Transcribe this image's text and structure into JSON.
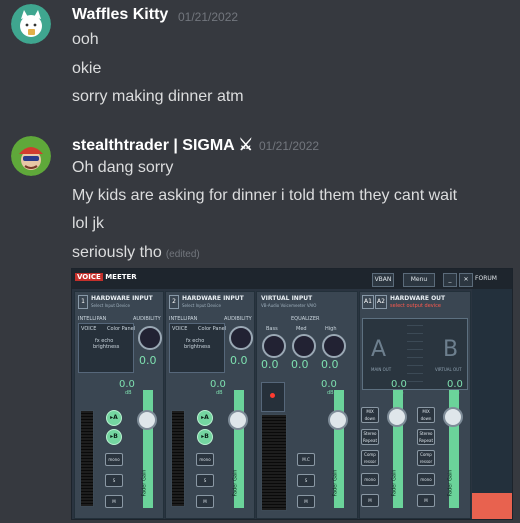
{
  "messages": [
    {
      "username": "Waffles Kitty",
      "timestamp": "01/21/2022",
      "avatar_colors": {
        "bg": "#3fa68f",
        "fg": "#ffffff"
      },
      "lines": [
        "ooh",
        "okie",
        "sorry making dinner atm"
      ]
    },
    {
      "username": "stealthtrader | SIGMA ⚔",
      "timestamp": "01/21/2022",
      "avatar_colors": {
        "bg": "#5fa83a",
        "fg": "#d13b2e"
      },
      "lines": [
        "Oh dang sorry",
        "My kids are asking for dinner i told them they cant wait",
        "lol jk",
        "seriously tho"
      ],
      "edited_label": "(edited)"
    }
  ],
  "attachment": {
    "title_voice": "VOICE",
    "title_meeter": "MEETER",
    "vban_label": "VBAN",
    "menu_label": "Menu",
    "min_label": "_",
    "close_label": "✕",
    "forum_label": "FORUM",
    "strips": [
      {
        "number": "1",
        "header": "HARDWARE INPUT",
        "sub": "Select Input Device",
        "intelli_label": "INTELLIPAN",
        "audibility_label": "AUDIBILITY",
        "voice_label": "VOICE",
        "color_panel_label": "Color Panel",
        "fx_label": "fx echo",
        "brightness_label": "brightness",
        "value": "0.0",
        "db": "0.0",
        "db_unit": "dB",
        "a_label": "▸A",
        "b_label": "▸B",
        "mono_label": "mono",
        "solo_label": "S",
        "mute_label": "M",
        "fader_label": "Fader Gain"
      },
      {
        "number": "2",
        "header": "HARDWARE INPUT",
        "sub": "Select Input Device",
        "intelli_label": "INTELLIPAN",
        "audibility_label": "AUDIBILITY",
        "voice_label": "VOICE",
        "color_panel_label": "Color Panel",
        "fx_label": "fx echo",
        "brightness_label": "brightness",
        "value": "0.0",
        "db": "0.0",
        "db_unit": "dB",
        "a_label": "▸A",
        "b_label": "▸B",
        "mono_label": "mono",
        "solo_label": "S",
        "mute_label": "M",
        "fader_label": "Fader Gain"
      }
    ],
    "virtual": {
      "header": "VIRTUAL INPUT",
      "sub": "VB-Audio Voicemeeter VAIO",
      "eq_label": "EQUALIZER",
      "bass": "Bass",
      "med": "Med",
      "high": "High",
      "eq_values": [
        "0.0",
        "0.0",
        "0.0"
      ],
      "db": "0.0",
      "db_unit": "dB",
      "mc_label": "M.C",
      "solo_label": "S",
      "mute_label": "M",
      "fader_label": "Fader Gain"
    },
    "output": {
      "a1": "A1",
      "a2": "A2",
      "header": "HARDWARE OUT",
      "warning": "select output device",
      "main_label": "MAIN OUT",
      "virtual_label": "VIRTUAL OUT",
      "a_big": "A",
      "b_big": "B",
      "buses": [
        {
          "db": "0.0",
          "db_unit": "dB",
          "mix_label": "MIX",
          "mix_sub": "down",
          "stereo_label": "Stereo Repeat",
          "comp_label": "Comp ressor",
          "mono_label": "mono",
          "mute_label": "M",
          "fader_label": "Fader Gain"
        },
        {
          "db": "0.0",
          "db_unit": "dB",
          "mix_label": "MIX",
          "mix_sub": "down",
          "stereo_label": "Stereo Repeat",
          "comp_label": "Comp ressor",
          "mono_label": "mono",
          "mute_label": "M",
          "fader_label": "Fader Gain"
        }
      ]
    }
  }
}
